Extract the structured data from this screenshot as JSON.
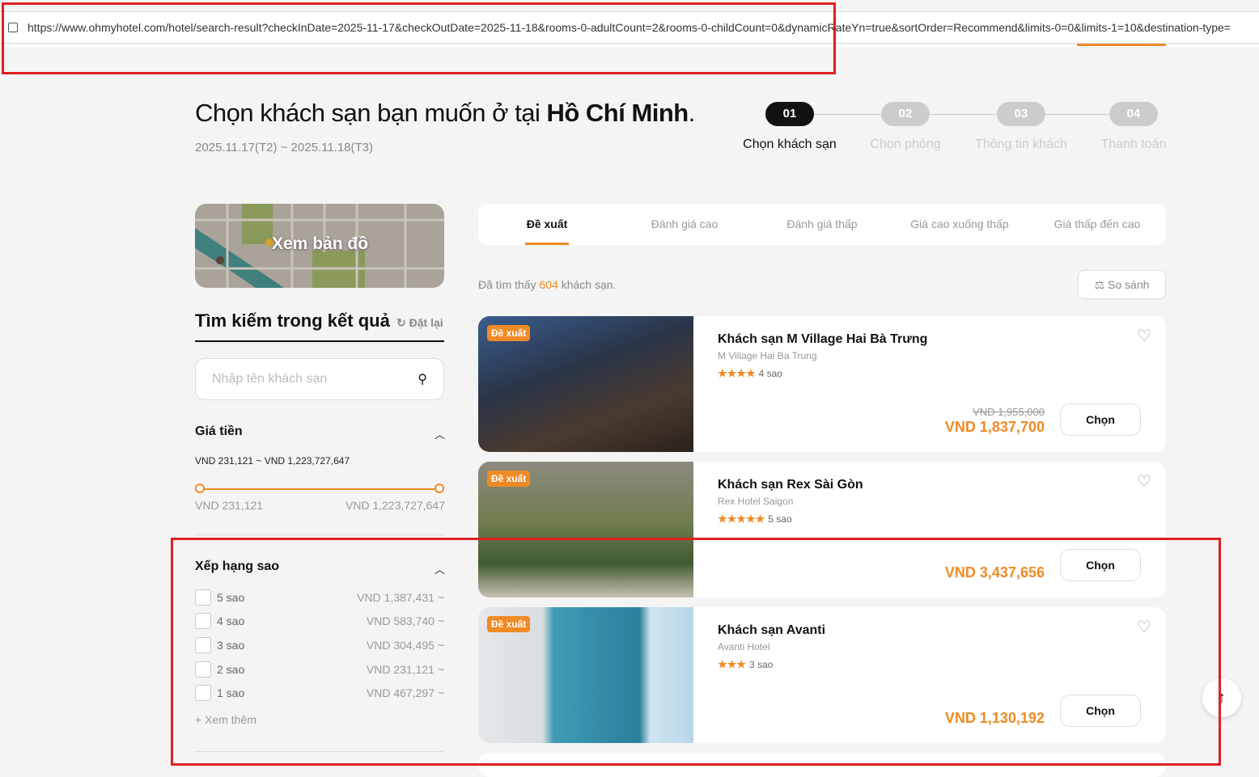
{
  "browser": {
    "url": "https://www.ohmyhotel.com/hotel/search-result?checkInDate=2025-11-17&checkOutDate=2025-11-18&rooms-0-adultCount=2&rooms-0-childCount=0&dynamicRateYn=true&sortOrder=Recommend&limits-0=0&limits-1=10&destination-type="
  },
  "header": {
    "title_prefix": "Chọn khách sạn bạn muốn ở tại ",
    "city": "Hồ Chí Minh",
    "title_suffix": ".",
    "dates": "2025.11.17(T2) ~ 2025.11.18(T3)"
  },
  "steps": [
    {
      "num": "01",
      "label": "Chọn khách sạn"
    },
    {
      "num": "02",
      "label": "Chọn phòng"
    },
    {
      "num": "03",
      "label": "Thông tin khách"
    },
    {
      "num": "04",
      "label": "Thanh toán"
    }
  ],
  "sidebar": {
    "map_label": "Xem bản đồ",
    "search_title": "Tìm kiếm trong kết quả",
    "reset": "Đặt lại",
    "search_placeholder": "Nhập tên khách sạn",
    "price": {
      "title": "Giá tiền",
      "range": "VND 231,121 ~ VND 1,223,727,647",
      "min": "VND 231,121",
      "max": "VND 1,223,727,647"
    },
    "stars": {
      "title": "Xếp hạng sao",
      "items": [
        {
          "label": "5 sao",
          "price": "VND 1,387,431 ~"
        },
        {
          "label": "4 sao",
          "price": "VND 583,740 ~"
        },
        {
          "label": "3 sao",
          "price": "VND 304,495 ~"
        },
        {
          "label": "2 sao",
          "price": "VND 231,121 ~"
        },
        {
          "label": "1 sao",
          "price": "VND 467,297 ~"
        }
      ],
      "more": "Xem thêm"
    }
  },
  "sort_tabs": [
    "Đề xuất",
    "Đánh giá cao",
    "Đánh giá thấp",
    "Giá cao xuống thấp",
    "Giá thấp đến cao"
  ],
  "results": {
    "prefix": "Đã tìm thấy",
    "count": "604",
    "suffix": "khách sạn.",
    "compare": "So sánh"
  },
  "hotels": [
    {
      "badge": "Đề xuất",
      "name": "Khách sạn M Village Hai Bà Trưng",
      "en": "M Village Hai Ba Trung",
      "stars": "★★★★",
      "star_label": "4 sao",
      "old_price": "VND 1,955,000",
      "price": "VND 1,837,700",
      "button": "Chọn"
    },
    {
      "badge": "Đề xuất",
      "name": "Khách sạn Rex Sài Gòn",
      "en": "Rex Hotel Saigon",
      "stars": "★★★★★",
      "star_label": "5 sao",
      "old_price": "",
      "price": "VND 3,437,656",
      "button": "Chọn"
    },
    {
      "badge": "Đề xuất",
      "name": "Khách sạn Avanti",
      "en": "Avanti Hotel",
      "stars": "★★★",
      "star_label": "3 sao",
      "old_price": "",
      "price": "VND 1,130,192",
      "button": "Chọn"
    }
  ]
}
